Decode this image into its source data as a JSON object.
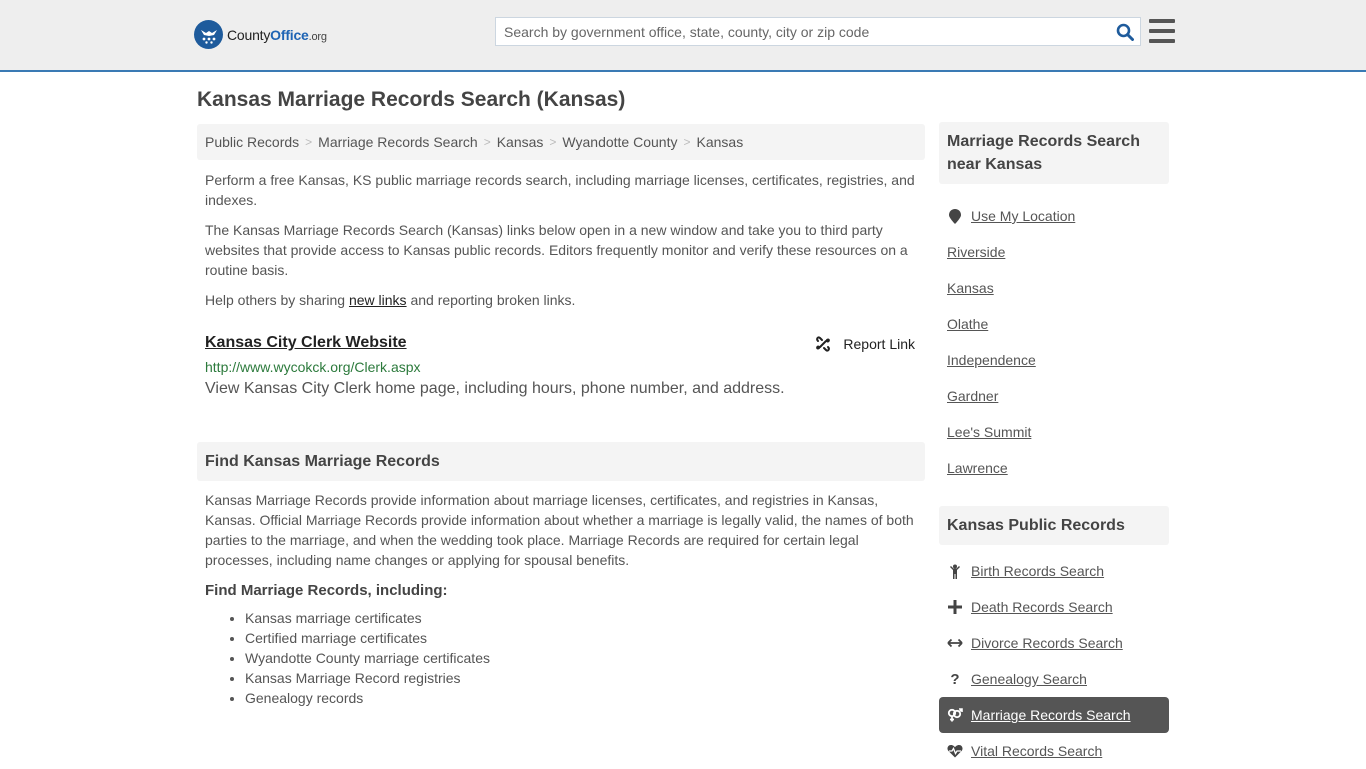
{
  "header": {
    "logo": {
      "county": "County",
      "office": "Office",
      "tld": ".org"
    },
    "search": {
      "placeholder": "Search by government office, state, county, city or zip code",
      "value": ""
    },
    "icons": {
      "search": "search-icon",
      "menu": "hamburger-menu-icon"
    }
  },
  "page": {
    "title": "Kansas Marriage Records Search (Kansas)"
  },
  "breadcrumb": [
    {
      "label": "Public Records"
    },
    {
      "label": "Marriage Records Search"
    },
    {
      "label": "Kansas"
    },
    {
      "label": "Wyandotte County"
    },
    {
      "label": "Kansas"
    }
  ],
  "intro": {
    "p1": "Perform a free Kansas, KS public marriage records search, including marriage licenses, certificates, registries, and indexes.",
    "p2": "The Kansas Marriage Records Search (Kansas) links below open in a new window and take you to third party websites that provide access to Kansas public records. Editors frequently monitor and verify these resources on a routine basis.",
    "p3_before": "Help others by sharing ",
    "p3_link": "new links",
    "p3_after": " and reporting broken links."
  },
  "resources": [
    {
      "title": "Kansas City Clerk Website",
      "url": "http://www.wycokck.org/Clerk.aspx",
      "description": "View Kansas City Clerk home page, including hours, phone number, and address.",
      "report_label": "Report Link"
    }
  ],
  "find_section": {
    "heading": "Find Kansas Marriage Records",
    "body": "Kansas Marriage Records provide information about marriage licenses, certificates, and registries in Kansas, Kansas. Official Marriage Records provide information about whether a marriage is legally valid, the names of both parties to the marriage, and when the wedding took place. Marriage Records are required for certain legal processes, including name changes or applying for spousal benefits.",
    "subheading": "Find Marriage Records, including:",
    "items": [
      "Kansas marriage certificates",
      "Certified marriage certificates",
      "Wyandotte County marriage certificates",
      "Kansas Marriage Record registries",
      "Genealogy records"
    ]
  },
  "sidebar": {
    "nearby_heading": "Marriage Records Search near Kansas",
    "use_location": "Use My Location",
    "nearby": [
      "Riverside",
      "Kansas",
      "Olathe",
      "Independence",
      "Gardner",
      "Lee's Summit",
      "Lawrence"
    ],
    "records_heading": "Kansas Public Records",
    "records": [
      {
        "label": "Birth Records Search",
        "icon": "child-icon",
        "active": false
      },
      {
        "label": "Death Records Search",
        "icon": "cross-icon",
        "active": false
      },
      {
        "label": "Divorce Records Search",
        "icon": "arrows-horizontal-icon",
        "active": false
      },
      {
        "label": "Genealogy Search",
        "icon": "question-icon",
        "active": false
      },
      {
        "label": "Marriage Records Search",
        "icon": "venus-mars-icon",
        "active": true
      },
      {
        "label": "Vital Records Search",
        "icon": "heartbeat-icon",
        "active": false
      }
    ],
    "colors": {
      "active_bg": "#555555"
    }
  },
  "colors": {
    "accent": "#3a7ab4",
    "link_green": "#2c7a3c",
    "brand_blue": "#1e5b9c"
  }
}
